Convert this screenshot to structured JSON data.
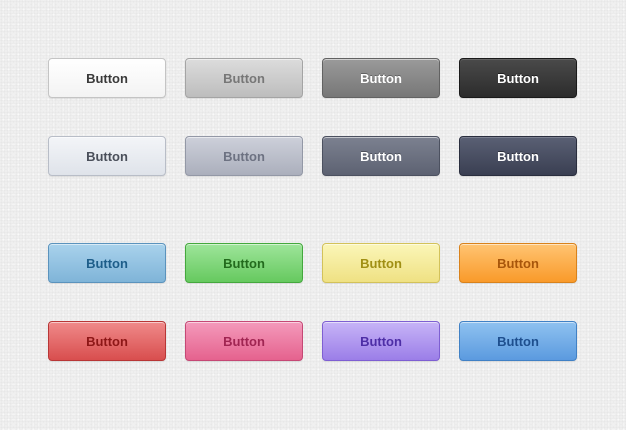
{
  "buttons": [
    {
      "label": "Button",
      "style": "white",
      "background": "#ffffff",
      "text_color": "#3a3a3a"
    },
    {
      "label": "Button",
      "style": "light-gray",
      "background": "#cccccc",
      "text_color": "#777777"
    },
    {
      "label": "Button",
      "style": "dark-gray",
      "background": "#888888",
      "text_color": "#ffffff"
    },
    {
      "label": "Button",
      "style": "black",
      "background": "#3a3a3a",
      "text_color": "#ffffff"
    },
    {
      "label": "Button",
      "style": "pale-blue-gray",
      "background": "#e8ebf0",
      "text_color": "#4a4f5a"
    },
    {
      "label": "Button",
      "style": "slate",
      "background": "#bcc0cb",
      "text_color": "#6d7282"
    },
    {
      "label": "Button",
      "style": "dark-slate",
      "background": "#6d7181",
      "text_color": "#ffffff"
    },
    {
      "label": "Button",
      "style": "navy",
      "background": "#4a4f63",
      "text_color": "#ffffff"
    },
    {
      "label": "Button",
      "style": "blue",
      "background": "#94c3e2",
      "text_color": "#1e5e8a"
    },
    {
      "label": "Button",
      "style": "green",
      "background": "#82d77c",
      "text_color": "#236b1d"
    },
    {
      "label": "Button",
      "style": "yellow",
      "background": "#f5eb9d",
      "text_color": "#a08f14"
    },
    {
      "label": "Button",
      "style": "orange",
      "background": "#fcaf4e",
      "text_color": "#a8560b"
    },
    {
      "label": "Button",
      "style": "red",
      "background": "#e46c6c",
      "text_color": "#8d1717"
    },
    {
      "label": "Button",
      "style": "pink",
      "background": "#ec7ea4",
      "text_color": "#a02552"
    },
    {
      "label": "Button",
      "style": "purple",
      "background": "#b199ef",
      "text_color": "#4d2ea6"
    },
    {
      "label": "Button",
      "style": "sky-blue",
      "background": "#75aee7",
      "text_color": "#1e4f8e"
    }
  ]
}
